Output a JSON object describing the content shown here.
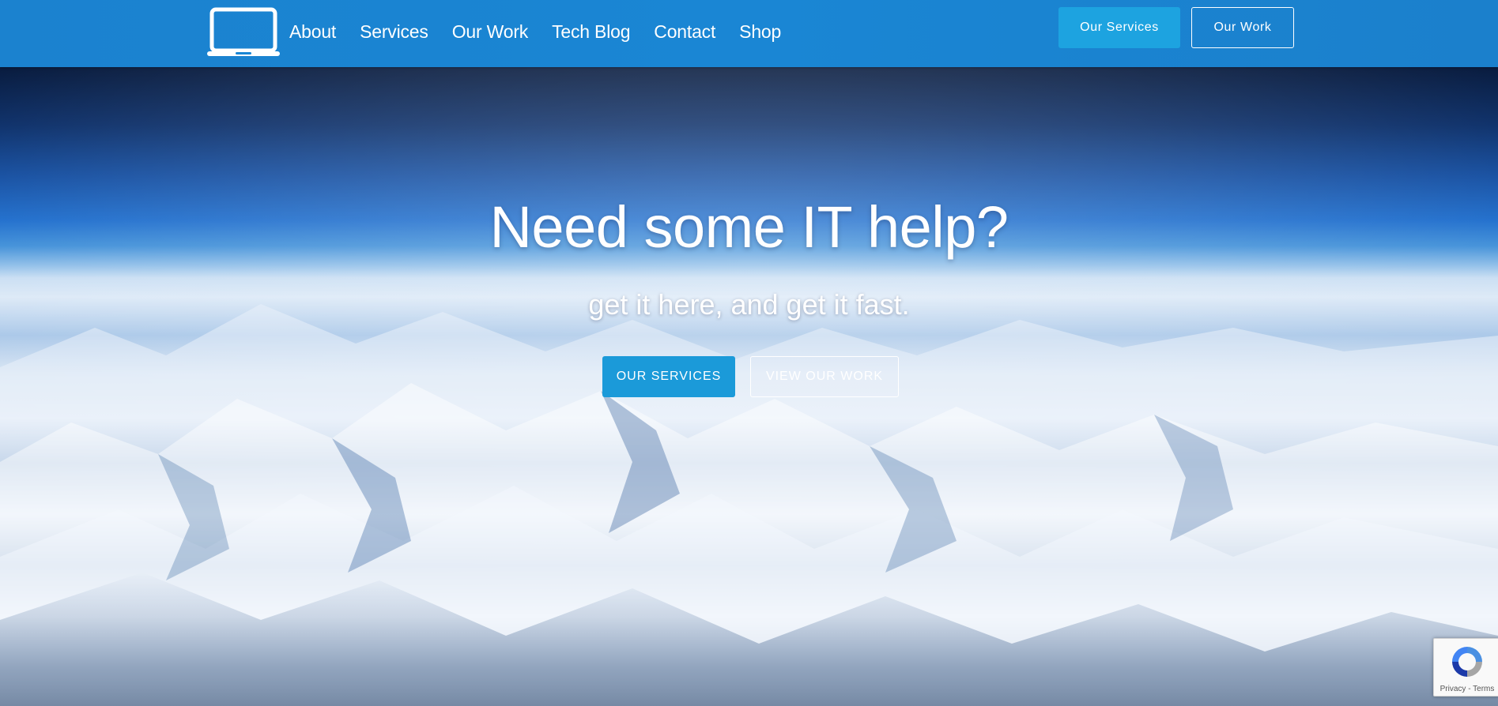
{
  "header": {
    "logo_icon": "laptop-icon",
    "nav": [
      {
        "label": "About"
      },
      {
        "label": "Services"
      },
      {
        "label": "Our Work"
      },
      {
        "label": "Tech Blog"
      },
      {
        "label": "Contact"
      },
      {
        "label": "Shop"
      }
    ],
    "primary_button": "Our Services",
    "secondary_button": "Our Work"
  },
  "hero": {
    "title": "Need some IT help?",
    "subtitle": "get it here, and get it fast.",
    "primary_button": "OUR SERVICES",
    "secondary_button": "VIEW OUR WORK"
  },
  "recaptcha": {
    "privacy": "Privacy",
    "separator": " - ",
    "terms": "Terms"
  },
  "colors": {
    "header_bg": "#1a86d4",
    "button_primary": "#1da3e0",
    "text": "#ffffff"
  }
}
